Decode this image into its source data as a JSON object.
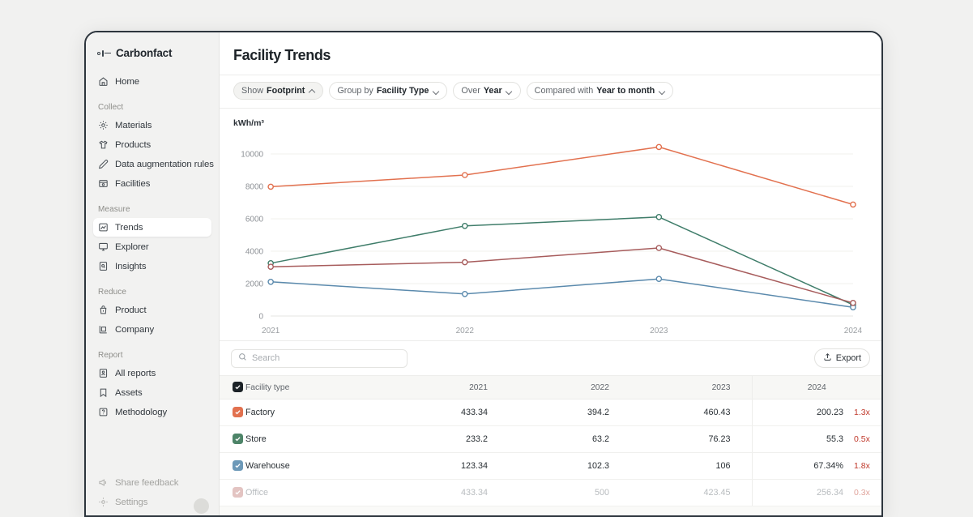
{
  "app": {
    "brand": "Carbonfact",
    "logo_icon": "carbonfact-logo-mark"
  },
  "sidebar": {
    "top_items": [
      {
        "label": "Home",
        "icon": "home-icon",
        "key": "home"
      }
    ],
    "sections": [
      {
        "title": "Collect",
        "items": [
          {
            "label": "Materials",
            "icon": "materials-gear-icon",
            "key": "materials"
          },
          {
            "label": "Products",
            "icon": "products-shirt-icon",
            "key": "products"
          },
          {
            "label": "Data augmentation rules",
            "icon": "pencil-icon",
            "key": "data-augmentation-rules"
          },
          {
            "label": "Facilities",
            "icon": "facilities-store-icon",
            "key": "facilities"
          }
        ]
      },
      {
        "title": "Measure",
        "items": [
          {
            "label": "Trends",
            "icon": "trends-chart-icon",
            "key": "trends",
            "active": true
          },
          {
            "label": "Explorer",
            "icon": "explorer-monitor-icon",
            "key": "explorer"
          },
          {
            "label": "Insights",
            "icon": "insights-document-icon",
            "key": "insights"
          }
        ]
      },
      {
        "title": "Reduce",
        "items": [
          {
            "label": "Product",
            "icon": "product-bag-icon",
            "key": "reduce-product"
          },
          {
            "label": "Company",
            "icon": "company-building-icon",
            "key": "reduce-company"
          }
        ]
      },
      {
        "title": "Report",
        "items": [
          {
            "label": "All reports",
            "icon": "reports-icon",
            "key": "all-reports"
          },
          {
            "label": "Assets",
            "icon": "bookmark-icon",
            "key": "assets"
          },
          {
            "label": "Methodology",
            "icon": "question-icon",
            "key": "methodology"
          }
        ]
      }
    ],
    "bottom_items": [
      {
        "label": "Share feedback",
        "icon": "megaphone-icon",
        "key": "share-feedback"
      },
      {
        "label": "Settings",
        "icon": "settings-gear-icon",
        "key": "settings"
      }
    ]
  },
  "header": {
    "title": "Facility Trends"
  },
  "toolbar": {
    "filters": [
      {
        "prefix": "Show",
        "value": "Footprint",
        "chevron": "up",
        "filled": true,
        "key": "show-footprint"
      },
      {
        "prefix": "Group by",
        "value": "Facility Type",
        "chevron": "down",
        "filled": false,
        "key": "group-by"
      },
      {
        "prefix": "Over",
        "value": "Year",
        "chevron": "down",
        "filled": false,
        "key": "over"
      },
      {
        "prefix": "Compared with",
        "value": "Year to month",
        "chevron": "down",
        "filled": false,
        "key": "compared-with"
      }
    ]
  },
  "chart_data": {
    "type": "line",
    "title": "Facility Trends",
    "unit_label": "kWh/m³",
    "xlabel": "",
    "ylabel": "kWh/m³",
    "categories": [
      "2021",
      "2022",
      "2023",
      "2024"
    ],
    "x_tick_labels": [
      "2021",
      "2022",
      "2023",
      "2024"
    ],
    "y_tick_labels": [
      "0",
      "2000",
      "4000",
      "6000",
      "8000",
      "10000"
    ],
    "y_ticks": [
      0,
      2000,
      4000,
      6000,
      8000,
      10000
    ],
    "ylim": [
      0,
      11000
    ],
    "grid": true,
    "legend": "none",
    "series": [
      {
        "name": "Factory",
        "color": "#e2714f",
        "values": [
          7980,
          8700,
          10430,
          6880
        ]
      },
      {
        "name": "Store",
        "color": "#3f7d6a",
        "values": [
          3260,
          5560,
          6110,
          690
        ]
      },
      {
        "name": "Warehouse",
        "color": "#5b8aad",
        "values": [
          2110,
          1360,
          2290,
          540
        ]
      },
      {
        "name": "Office",
        "color": "#a75c5c",
        "values": [
          3040,
          3320,
          4200,
          810
        ]
      }
    ]
  },
  "table": {
    "search": {
      "placeholder": "Search",
      "value": "",
      "icon": "search-icon"
    },
    "export": {
      "label": "Export",
      "icon": "export-upload-icon"
    },
    "header_checkbox": {
      "checked": true,
      "color": "#1b2227"
    },
    "columns": [
      "Facility type",
      "2021",
      "2022",
      "2023",
      "2024"
    ],
    "rows": [
      {
        "name": "Factory",
        "checked": true,
        "color": "#e2714f",
        "dim": false,
        "values": [
          "433.34",
          "394.2",
          "460.43",
          "200.23"
        ],
        "multiplier": "1.3x"
      },
      {
        "name": "Store",
        "checked": true,
        "color": "#4d8468",
        "dim": false,
        "values": [
          "233.2",
          "63.2",
          "76.23",
          "55.3"
        ],
        "multiplier": "0.5x"
      },
      {
        "name": "Warehouse",
        "checked": true,
        "color": "#6d99b8",
        "dim": false,
        "values": [
          "123.34",
          "102.3",
          "106",
          "67.34%"
        ],
        "multiplier": "1.8x"
      },
      {
        "name": "Office",
        "checked": true,
        "color": "#e3c4c2",
        "dim": true,
        "values": [
          "433.34",
          "500",
          "423.45",
          "256.34"
        ],
        "multiplier": "0.3x"
      }
    ]
  }
}
